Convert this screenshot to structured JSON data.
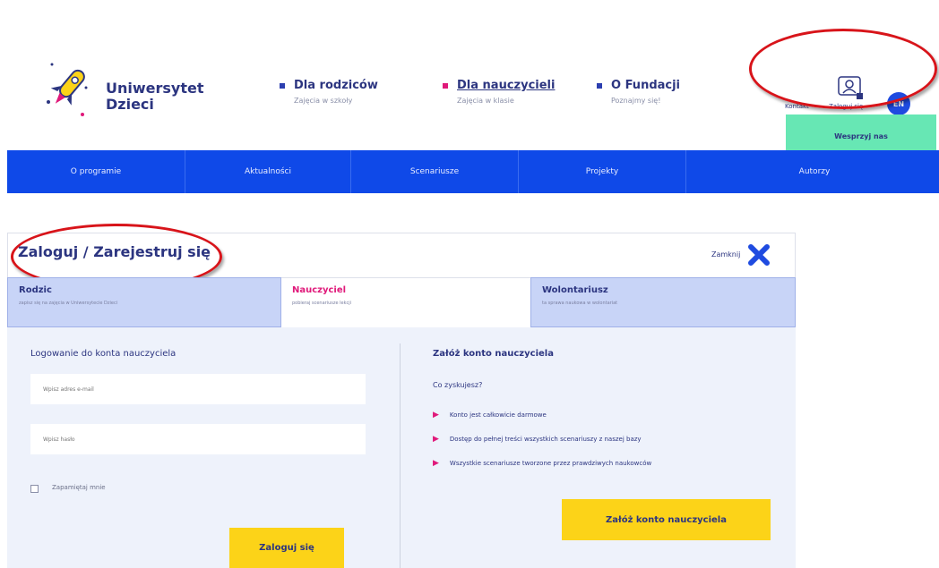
{
  "header": {
    "logo_line1": "Uniwersytet",
    "logo_line2": "Dzieci",
    "nav": [
      {
        "title": "Dla rodziców",
        "sub": "Zajęcia w szkoły"
      },
      {
        "title": "Dla nauczycieli",
        "sub": "Zajęcia w klasie"
      },
      {
        "title": "O Fundacji",
        "sub": "Poznajmy się!"
      }
    ],
    "kontakt": "Kontakt",
    "zaloguj": "Zaloguj się",
    "lang": "EN",
    "wesprzyj": "Wesprzyj nas"
  },
  "menu": [
    "O programie",
    "Aktualności",
    "Scenariusze",
    "Projekty",
    "Autorzy"
  ],
  "panel": {
    "title": "Zaloguj / Zarejestruj się",
    "close_label": "Zamknij",
    "tabs": [
      {
        "label": "Rodzic",
        "sub": "zapisz się na zajęcia w Uniwersytecie Dzieci"
      },
      {
        "label": "Nauczyciel",
        "sub": "pobieraj scenariusze lekcji"
      },
      {
        "label": "Wolontariusz",
        "sub": "ta sprawa naukowa w wolontariat"
      }
    ],
    "login": {
      "heading": "Logowanie do konta nauczyciela",
      "email_placeholder": "Wpisz adres e-mail",
      "password_placeholder": "Wpisz hasło",
      "remember": "Zapamiętaj mnie",
      "button": "Zaloguj się"
    },
    "register": {
      "heading": "Załóż konto nauczyciela",
      "sub": "Co zyskujesz?",
      "benefits": [
        "Konto jest całkowicie darmowe",
        "Dostęp do pełnej treści wszystkich scenariuszy z naszej bazy",
        "Wszystkie scenariusze tworzone przez prawdziwych naukowców"
      ],
      "button": "Załóż konto nauczyciela"
    }
  },
  "colors": {
    "menu_blue": "#0f49e8",
    "accent_pink": "#e0197a",
    "button_yellow": "#fcd318",
    "support_green": "#67e7b4",
    "annotation_red": "#d8141a"
  }
}
